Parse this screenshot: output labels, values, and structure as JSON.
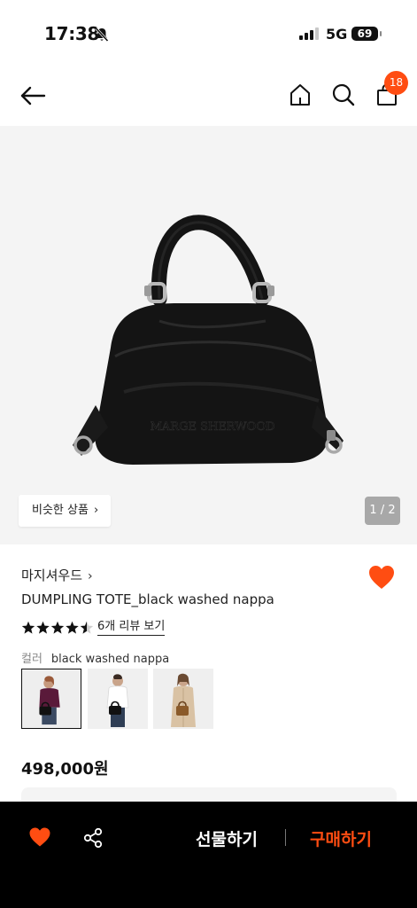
{
  "status_bar": {
    "time": "17:38",
    "network": "5G",
    "battery": "69"
  },
  "nav": {
    "cart_count": "18"
  },
  "gallery": {
    "similar_label": "비슷한 상품",
    "page_indicator": "1 / 2",
    "image_logo_text": "MARGE SHERWOOD"
  },
  "product": {
    "brand": "마지셔우드",
    "name": "DUMPLING TOTE_black washed nappa",
    "rating": 4.5,
    "review_link": "6개 리뷰 보기",
    "color_label": "컬러",
    "color_value": "black washed nappa",
    "price": "498,000원",
    "variant_thumbnails": [
      {
        "label": "model-burgundy-sweater",
        "selected": true
      },
      {
        "label": "model-white-shirt",
        "selected": false
      },
      {
        "label": "model-trench-coat",
        "selected": false
      }
    ]
  },
  "bottom_bar": {
    "gift_label": "선물하기",
    "buy_label": "구매하기"
  },
  "colors": {
    "accent": "#ff4d12",
    "heart": "#ff4d12",
    "bottom_bar_bg": "#000000",
    "hero_bg": "#f4f4f4"
  }
}
